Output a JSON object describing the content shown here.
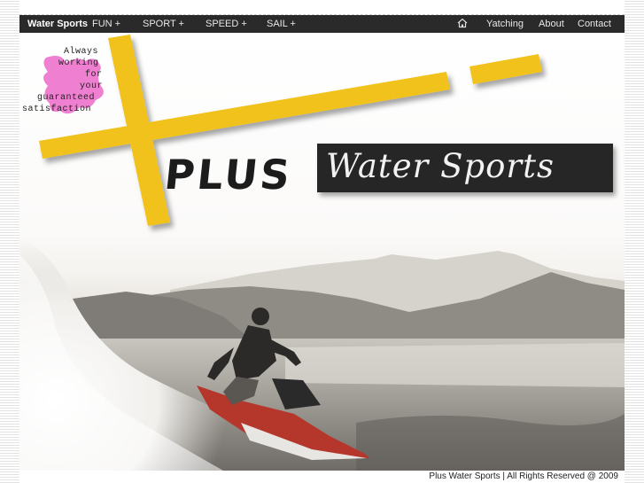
{
  "nav": {
    "brand": "Water Sports",
    "items": [
      {
        "label": "FUN +"
      },
      {
        "label": "SPORT +"
      },
      {
        "label": "SPEED +"
      },
      {
        "label": "SAIL +"
      }
    ],
    "right_items": [
      {
        "label": "Yatching"
      },
      {
        "label": "About"
      },
      {
        "label": "Contact"
      }
    ],
    "home_icon": "home-icon"
  },
  "hero": {
    "tagline_lines": [
      "Always",
      "working",
      "for",
      "your",
      "guaranteed",
      "satisfaction"
    ],
    "logo_plus": "PLUS",
    "logo_name": "Water Sports",
    "colors": {
      "plus_yellow": "#f2c21b",
      "splash_pink": "#ef7fd0",
      "logo_box": "#262626"
    }
  },
  "footer": {
    "copyright": "Plus Water Sports | All Rights Reserved @ 2009"
  }
}
